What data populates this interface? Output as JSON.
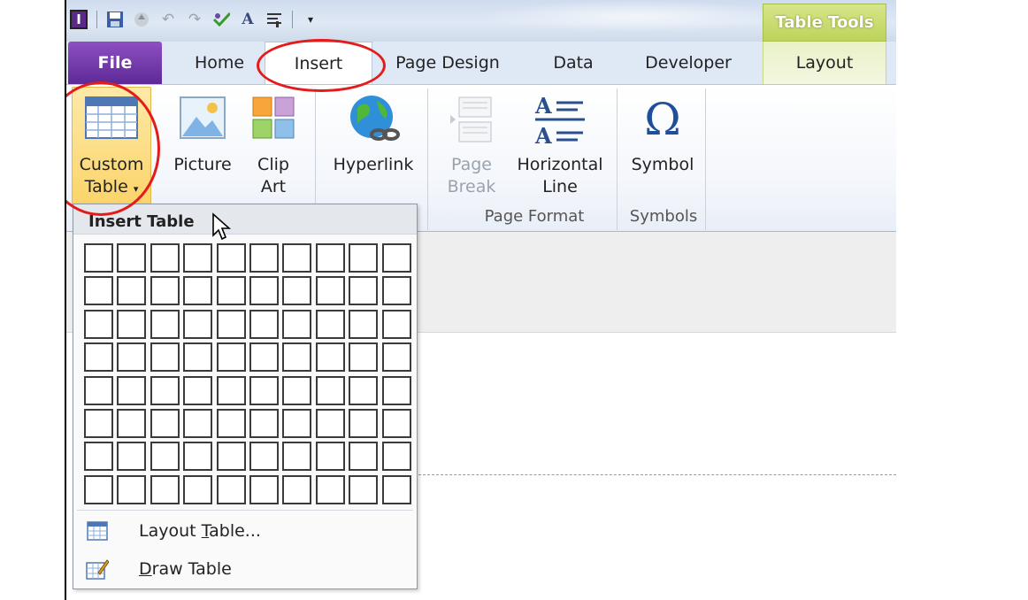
{
  "qat": {
    "app_icon": "I",
    "icons": [
      "save-icon",
      "sync-icon",
      "undo-icon",
      "redo-icon",
      "spelling-icon",
      "font-icon",
      "format-icon",
      "customize-icon"
    ]
  },
  "contextual": {
    "header": "Table Tools"
  },
  "tabs": {
    "file": "File",
    "home": "Home",
    "insert": "Insert",
    "page_design": "Page Design",
    "data": "Data",
    "developer": "Developer",
    "layout": "Layout"
  },
  "ribbon": {
    "custom_table": {
      "line1": "Custom",
      "line2": "Table"
    },
    "picture": "Picture",
    "clip_art": {
      "line1": "Clip",
      "line2": "Art"
    },
    "hyperlink": "Hyperlink",
    "page_break": {
      "line1": "Page",
      "line2": "Break"
    },
    "horizontal_line": {
      "line1": "Horizontal",
      "line2": "Line"
    },
    "symbol": "Symbol",
    "groups": {
      "page_format": "Page Format",
      "symbols": "Symbols"
    }
  },
  "dropdown": {
    "title": "Insert Table",
    "grid": {
      "rows": 8,
      "cols": 10
    },
    "layout_table": {
      "prefix": "Layout ",
      "underline": "T",
      "suffix": "able..."
    },
    "draw_table": {
      "prefix": "",
      "underline": "D",
      "suffix": "raw Table"
    }
  },
  "colors": {
    "annotation": "#e31b1b",
    "file_tab": "#6b2fa6",
    "contextual": "#c7d86a"
  }
}
